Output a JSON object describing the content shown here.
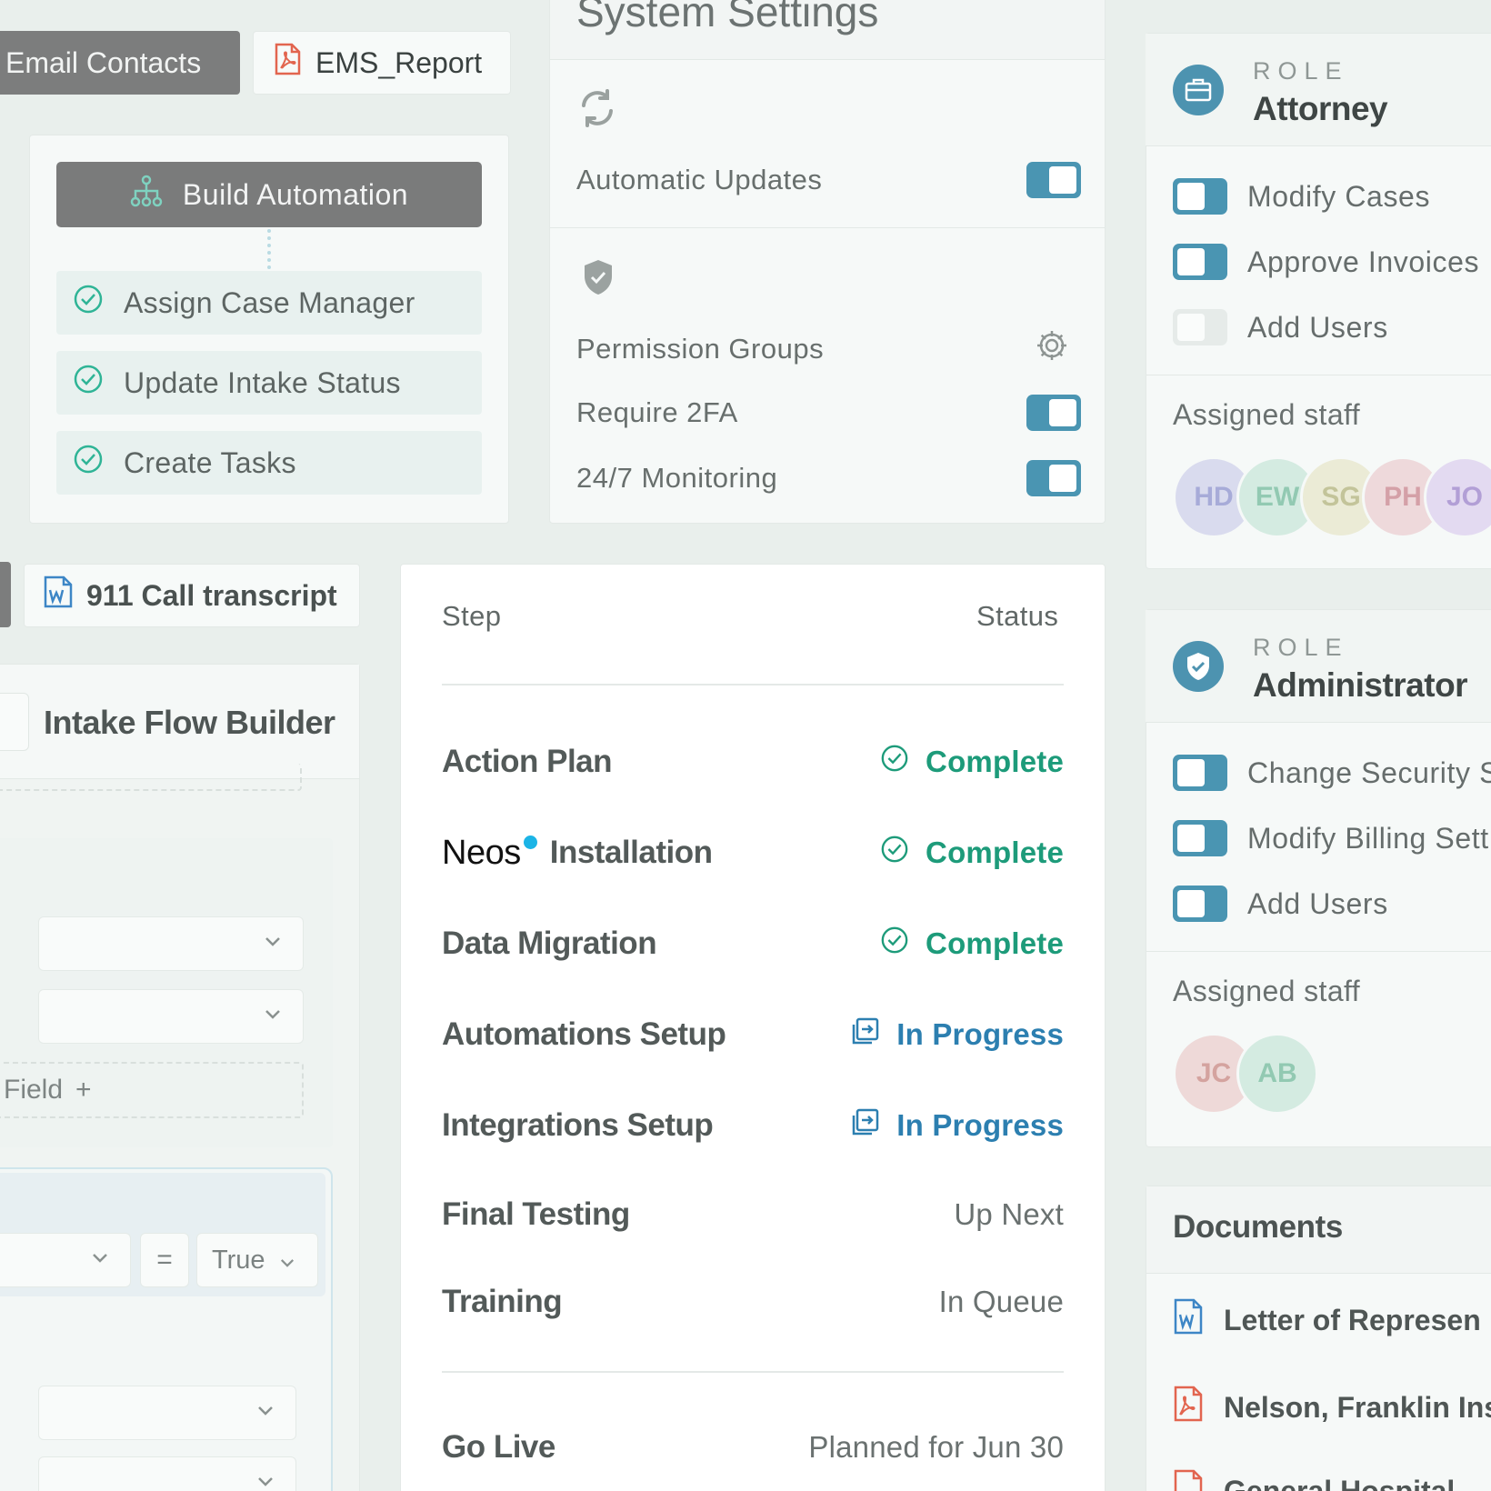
{
  "tabs": {
    "email_contacts": "Email Contacts",
    "ems_report": "EMS_Report",
    "call_transcript": "911 Call transcript"
  },
  "automation": {
    "button_label": "Build Automation",
    "steps": [
      "Assign Case Manager",
      "Update Intake Status",
      "Create Tasks"
    ]
  },
  "system_settings": {
    "title": "System Settings",
    "automatic_updates": "Automatic Updates",
    "permission_groups": "Permission Groups",
    "require_2fa": "Require 2FA",
    "monitoring": "24/7 Monitoring"
  },
  "intake_builder": {
    "title": "Intake Flow Builder",
    "add_field": "Field",
    "equals": "=",
    "true_value": "True"
  },
  "steps_table": {
    "col_step": "Step",
    "col_status": "Status",
    "rows": [
      {
        "step": "Action Plan",
        "status": "Complete"
      },
      {
        "step": "Installation",
        "brand": "Neos",
        "status": "Complete"
      },
      {
        "step": "Data Migration",
        "status": "Complete"
      },
      {
        "step": "Automations Setup",
        "status": "In Progress"
      },
      {
        "step": "Integrations Setup",
        "status": "In Progress"
      },
      {
        "step": "Final Testing",
        "status": "Up Next"
      },
      {
        "step": "Training",
        "status": "In Queue"
      }
    ],
    "go_live": {
      "step": "Go Live",
      "status": "Planned for Jun 30"
    }
  },
  "roles": [
    {
      "caption": "ROLE",
      "name": "Attorney",
      "permissions": [
        {
          "label": "Modify Cases",
          "enabled": true
        },
        {
          "label": "Approve Invoices",
          "enabled": true
        },
        {
          "label": "Add Users",
          "enabled": false
        }
      ],
      "staff_label": "Assigned staff",
      "staff": [
        "HD",
        "EW",
        "SG",
        "PH",
        "JO"
      ]
    },
    {
      "caption": "ROLE",
      "name": "Administrator",
      "permissions": [
        {
          "label": "Change Security S",
          "enabled": true
        },
        {
          "label": "Modify Billing Sett",
          "enabled": true
        },
        {
          "label": "Add Users",
          "enabled": true
        }
      ],
      "staff_label": "Assigned staff",
      "staff": [
        "JC",
        "AB"
      ]
    }
  ],
  "documents": {
    "title": "Documents",
    "items": [
      "Letter of Represen",
      "Nelson, Franklin Ins",
      "General Hospital"
    ]
  },
  "colors": {
    "accent_blue": "#4a95b2",
    "complete_green": "#1d9b7a",
    "progress_blue": "#2c7fb0",
    "pdf_red": "#e2654f",
    "word_blue": "#3d86c6"
  }
}
